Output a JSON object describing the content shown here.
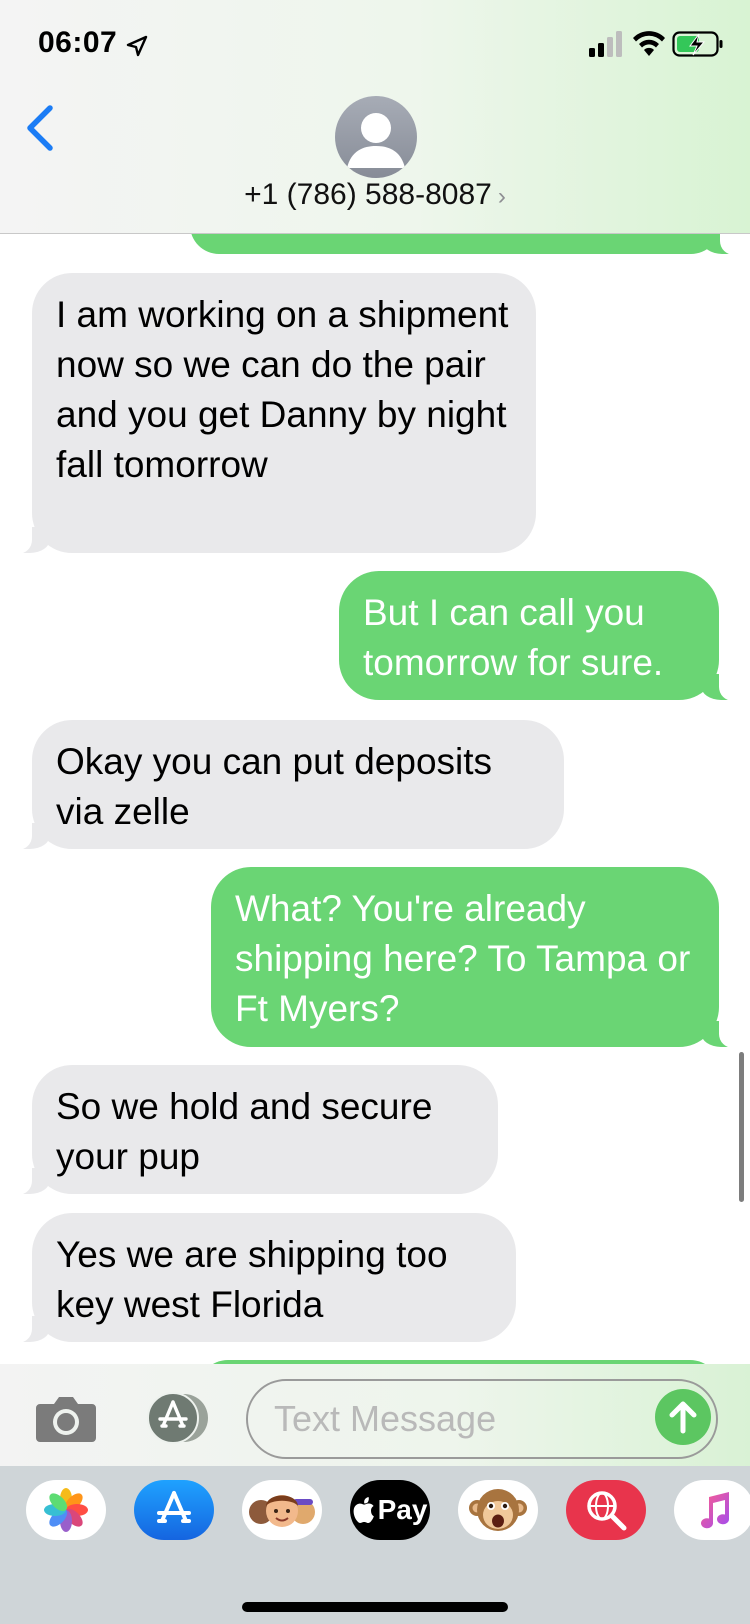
{
  "status_bar": {
    "time": "06:07",
    "icons": [
      "location-arrow-icon",
      "cellular-signal-icon",
      "wifi-icon",
      "battery-charging-icon"
    ]
  },
  "header": {
    "back_icon": "chevron-left-icon",
    "avatar_icon": "person-silhouette-icon",
    "contact_name": "+1 (786) 588-8087",
    "chevron": "›"
  },
  "messages": [
    {
      "direction": "outgoing",
      "text": ""
    },
    {
      "direction": "incoming",
      "text": "I am working on a shipment now so we can do the pair and you get Danny by night fall tomorrow"
    },
    {
      "direction": "outgoing",
      "text": "But I can call you tomorrow for sure."
    },
    {
      "direction": "incoming",
      "text": "Okay you can put deposits via zelle"
    },
    {
      "direction": "outgoing",
      "text": "What? You're already shipping here? To Tampa or Ft Myers?"
    },
    {
      "direction": "incoming",
      "text": "So we hold and secure your pup"
    },
    {
      "direction": "incoming",
      "text": "Yes we are shipping too key west Florida"
    },
    {
      "direction": "outgoing",
      "text": ""
    }
  ],
  "input_bar": {
    "camera_icon": "camera-icon",
    "apps_icon": "app-store-icon",
    "placeholder": "Text Message",
    "send_icon": "arrow-up-icon"
  },
  "app_drawer": {
    "apps": [
      {
        "name": "photos-app-icon"
      },
      {
        "name": "app-store-app-icon"
      },
      {
        "name": "memoji-app-icon"
      },
      {
        "name": "apple-pay-app-icon",
        "label": "Pay"
      },
      {
        "name": "animoji-app-icon"
      },
      {
        "name": "web-search-app-icon"
      },
      {
        "name": "music-app-icon"
      }
    ]
  },
  "colors": {
    "outgoing_bubble": "#6ad574",
    "incoming_bubble": "#e9e9eb",
    "ios_blue": "#1b7cf5",
    "send_button": "#5cc661"
  }
}
